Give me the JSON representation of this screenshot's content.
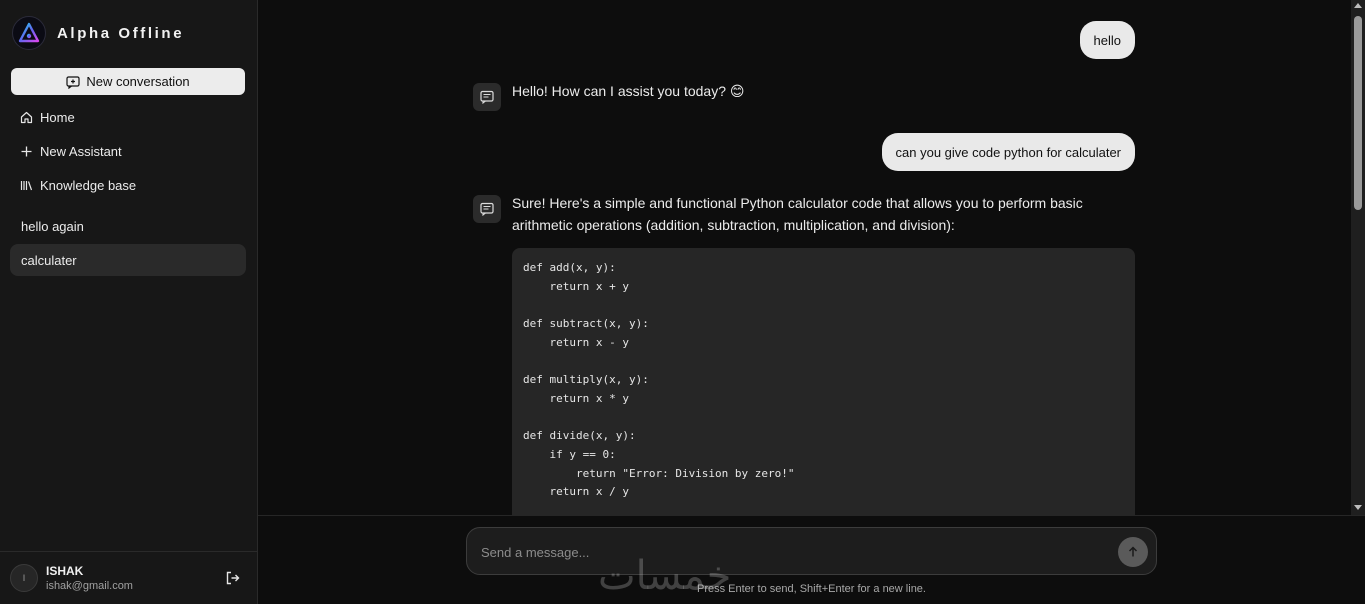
{
  "brand": {
    "title": "Alpha Offline"
  },
  "sidebar": {
    "new_conversation": "New conversation",
    "nav": [
      {
        "label": "Home",
        "icon": "home-icon"
      },
      {
        "label": "New Assistant",
        "icon": "plus-icon"
      },
      {
        "label": "Knowledge base",
        "icon": "library-icon"
      }
    ],
    "history": [
      {
        "label": "hello again"
      },
      {
        "label": "calculater"
      }
    ],
    "user": {
      "initial": "I",
      "name": "ISHAK",
      "email": "ishak@gmail.com"
    }
  },
  "messages": {
    "user_1": "hello",
    "bot_1": "Hello! How can I assist you today? 😊",
    "user_2": "can you give code python for calculater",
    "bot_2": "Sure! Here's a simple and functional Python calculator code that allows you to perform basic arithmetic operations (addition, subtraction, multiplication, and division):",
    "code": "def add(x, y):\n    return x + y\n\ndef subtract(x, y):\n    return x - y\n\ndef multiply(x, y):\n    return x * y\n\ndef divide(x, y):\n    if y == 0:\n        return \"Error: Division by zero!\"\n    return x / y\n\ndef calculator():"
  },
  "composer": {
    "placeholder": "Send a message...",
    "hint": "Press Enter to send, Shift+Enter for a new line."
  },
  "watermark": "خمسات",
  "colors": {
    "background": "#0d0d0d",
    "sidebar": "#171717",
    "bubble": "#e9e9e9",
    "code_bg": "#262626"
  }
}
